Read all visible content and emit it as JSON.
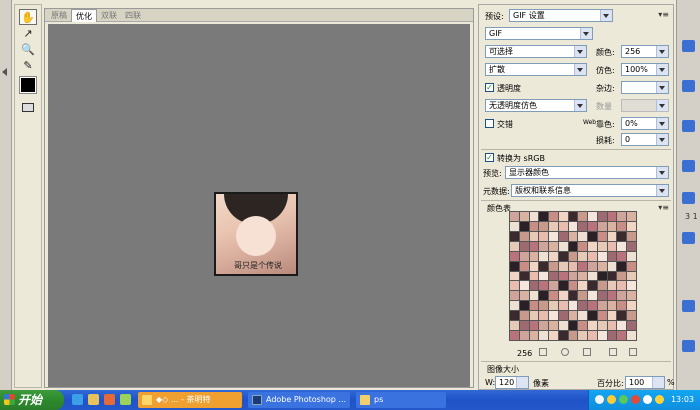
{
  "tools": [
    {
      "icon": "hand-icon",
      "glyph": "✋"
    },
    {
      "icon": "slice-select-icon",
      "glyph": "↗"
    },
    {
      "icon": "zoom-icon",
      "glyph": "🔍"
    },
    {
      "icon": "eyedropper-icon",
      "glyph": "✎"
    }
  ],
  "document": {
    "tabs": [
      "原稿",
      "优化",
      "双联",
      "四联"
    ],
    "active_tab": 1,
    "image_caption": "哥只是个传说"
  },
  "panel": {
    "preset_label": "预设:",
    "preset_value": "GIF 设置",
    "format_value": "GIF",
    "reduction_value": "可选择",
    "colors_label": "颜色:",
    "colors_value": "256",
    "dither_algo_value": "扩散",
    "dither_label": "仿色:",
    "dither_value": "100%",
    "transparency_label": "透明度",
    "transparency_checked": true,
    "matte_label": "杂边:",
    "matte_value": "",
    "trans_dither_value": "无透明度仿色",
    "amount_label": "数量",
    "amount_value": "",
    "interlaced_label": "交错",
    "interlaced_checked": false,
    "web_label": "Web",
    "websnap_label": "靠色:",
    "websnap_value": "0%",
    "lossy_label": "损耗:",
    "lossy_value": "0",
    "convert_label": "转换为 sRGB",
    "convert_checked": true,
    "preview_label": "预览:",
    "preview_value": "显示器颜色",
    "metadata_label": "元数据:",
    "metadata_value": "版权和联系信息",
    "color_table_title": "颜色表",
    "color_count": "256",
    "image_size_title": "图像大小",
    "width_label": "W:",
    "width_value": "120",
    "width_unit": "像素",
    "percent_label": "百分比:",
    "percent_value": "100",
    "percent_unit": "%",
    "color_table": [
      "#cfa49a",
      "#efe0d4",
      "#c88e86",
      "#3a2a2e",
      "#e6c9b6",
      "#f4e6dc",
      "#b8737c",
      "#d9b2a2",
      "#2b2026",
      "#f0d4c4",
      "#c79a8c",
      "#e8bcae",
      "#9c6a70"
    ]
  },
  "rail": {
    "number": "3 1"
  },
  "taskbar": {
    "start_label": "开始",
    "tasks": [
      {
        "label": "◆◇ ... - 茶明特",
        "color": "#f0a030",
        "active": true
      },
      {
        "label": "Adobe Photoshop ...",
        "color": "#2b63d4",
        "active": false
      },
      {
        "label": "ps",
        "color": "#2b63d4",
        "active": false
      }
    ],
    "clock": "13:03"
  }
}
